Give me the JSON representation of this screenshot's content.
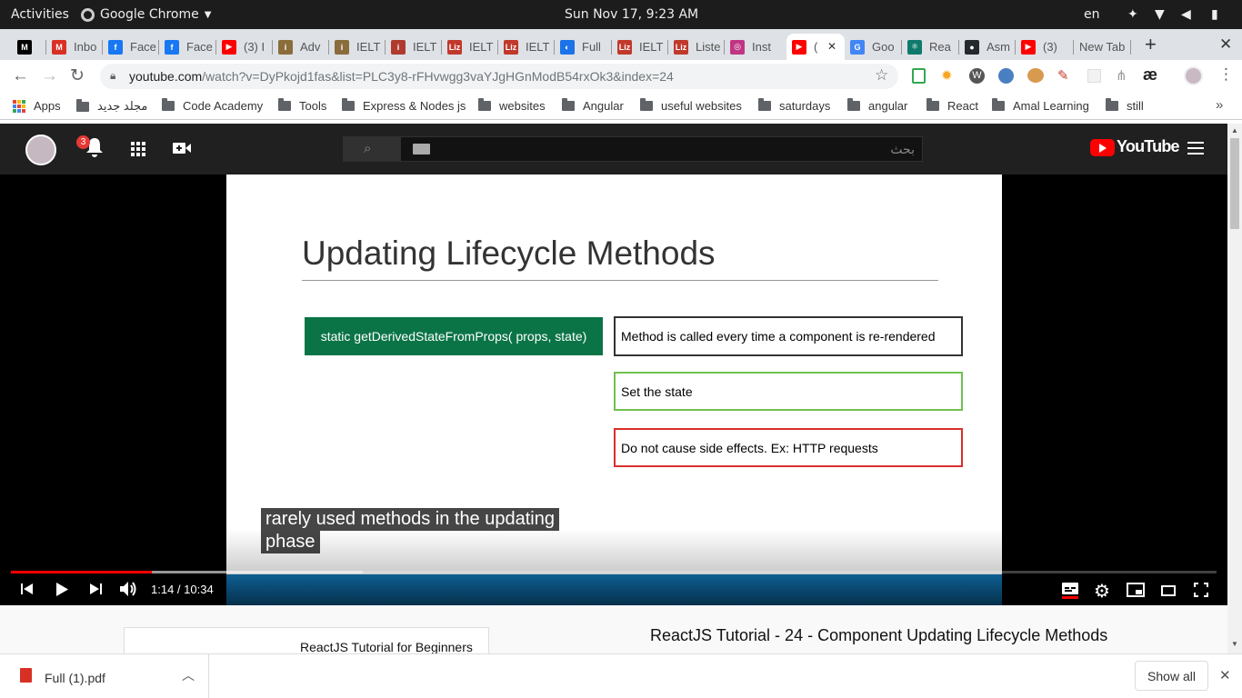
{
  "os_bar": {
    "activities": "Activities",
    "app_name": "Google Chrome",
    "clock": "Sun Nov 17,  9:23 AM",
    "language": "en"
  },
  "tabs": [
    {
      "label": "",
      "favicon": "M",
      "color": "#000000"
    },
    {
      "label": "Inbo",
      "favicon": "M",
      "color": "#d93025"
    },
    {
      "label": "Face",
      "favicon": "f",
      "color": "#1877f2"
    },
    {
      "label": "Face",
      "favicon": "f",
      "color": "#1877f2"
    },
    {
      "label": "(3) I",
      "favicon": "▶",
      "color": "#ff0000"
    },
    {
      "label": "Adv",
      "favicon": "i",
      "color": "#8a6d3b"
    },
    {
      "label": "IELT",
      "favicon": "i",
      "color": "#8a6d3b"
    },
    {
      "label": "IELT",
      "favicon": "i",
      "color": "#b03a2e"
    },
    {
      "label": "IELT",
      "favicon": "Liz",
      "color": "#c0392b"
    },
    {
      "label": "IELT",
      "favicon": "Liz",
      "color": "#c0392b"
    },
    {
      "label": "Full",
      "favicon": "◐",
      "color": "#1a73e8"
    },
    {
      "label": "IELT",
      "favicon": "Liz",
      "color": "#c0392b"
    },
    {
      "label": "Liste",
      "favicon": "Liz",
      "color": "#c0392b"
    },
    {
      "label": "Inst",
      "favicon": "◎",
      "color": "#c13584"
    },
    {
      "label": "(",
      "favicon": "▶",
      "color": "#ff0000",
      "active": true
    },
    {
      "label": "Goo",
      "favicon": "G",
      "color": "#4285f4"
    },
    {
      "label": "Rea",
      "favicon": "⚛",
      "color": "#0e7a6b"
    },
    {
      "label": "Asm",
      "favicon": "●",
      "color": "#24292e"
    },
    {
      "label": "(3)",
      "favicon": "▶",
      "color": "#ff0000"
    },
    {
      "label": "New Tab",
      "favicon": "",
      "color": "#dee1e6"
    }
  ],
  "address": {
    "domain": "youtube.com",
    "path": "/watch?v=DyPkojd1fas&list=PLC3y8-rFHvwgg3vaYJgHGnModB54rxOk3&index=24"
  },
  "bookmarks": {
    "apps": "Apps",
    "folders": [
      "مجلد جديد",
      "Code Academy",
      "Tools",
      "Express & Nodes js",
      "websites",
      "Angular",
      "useful websites",
      "saturdays",
      "angular",
      "React",
      "Amal Learning",
      "still"
    ]
  },
  "youtube": {
    "notification_count": "3",
    "search_placeholder": "بحث",
    "logo_text": "YouTube"
  },
  "slide": {
    "title": "Updating Lifecycle Methods",
    "method": "static getDerivedStateFromProps( props, state)",
    "box1": "Method is called every time a component is re-rendered",
    "box2": "Set the state",
    "box3": "Do not cause side effects. Ex: HTTP requests",
    "colors": {
      "green": "#0b7447",
      "box2_border": "#70c14f",
      "box3_border": "#d9302c"
    }
  },
  "caption": {
    "line1": "rarely used methods in the updating",
    "line2": "phase"
  },
  "player": {
    "time": "1:14 / 10:34",
    "progress": 0.117,
    "buffered": 0.292
  },
  "below": {
    "playlist_title": "ReactJS Tutorial for Beginners",
    "video_title": "ReactJS Tutorial - 24 - Component Updating Lifecycle Methods"
  },
  "downloads": {
    "file": "Full (1).pdf",
    "show_all": "Show all"
  }
}
